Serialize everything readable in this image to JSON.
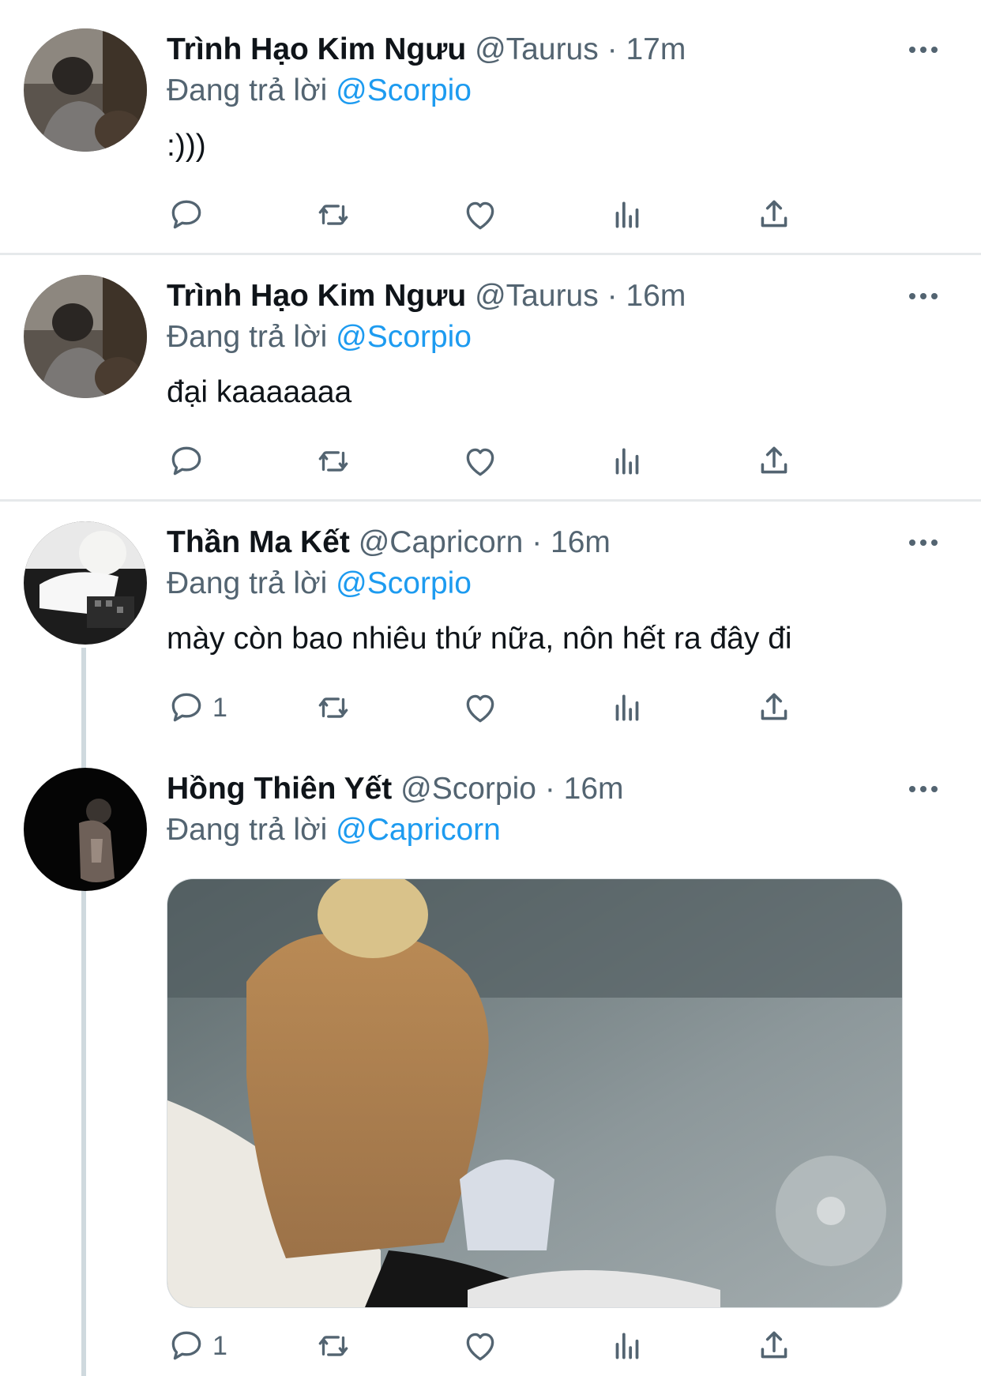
{
  "tweets": [
    {
      "name": "Trình Hạo Kim Ngưu",
      "handle": "@Taurus",
      "dot": "·",
      "time": "17m",
      "reply_prefix": "Đang trả lời",
      "reply_to": "@Scorpio",
      "text": ":)))",
      "reply_count": "",
      "avatar": "sleeping-person-gray-sweater"
    },
    {
      "name": "Trình Hạo Kim Ngưu",
      "handle": "@Taurus",
      "dot": "·",
      "time": "16m",
      "reply_prefix": "Đang trả lời",
      "reply_to": "@Scorpio",
      "text": "đại kaaaaaaa",
      "reply_count": "",
      "avatar": "sleeping-person-gray-sweater"
    },
    {
      "name": "Thần Ma Kết",
      "handle": "@Capricorn",
      "dot": "·",
      "time": "16m",
      "reply_prefix": "Đang trả lời",
      "reply_to": "@Scorpio",
      "text": "mày còn bao nhiêu thứ nữa, nôn hết ra đây đi",
      "reply_count": "1",
      "avatar": "white-haired-person-white-shirt"
    },
    {
      "name": "Hồng Thiên Yết",
      "handle": "@Scorpio",
      "dot": "·",
      "time": "16m",
      "reply_prefix": "Đang trả lời",
      "reply_to": "@Capricorn",
      "text": "",
      "reply_count": "1",
      "avatar": "dark-shirtless-figure",
      "media": "photo-person-back-blonde-hair"
    }
  ],
  "action_icons": [
    "comment-icon",
    "retweet-icon",
    "like-icon",
    "analytics-icon",
    "share-icon"
  ],
  "colors": {
    "mention": "#1d9bf0",
    "secondary": "#536471",
    "primary": "#0f1419",
    "divider": "#e6e9eb"
  }
}
